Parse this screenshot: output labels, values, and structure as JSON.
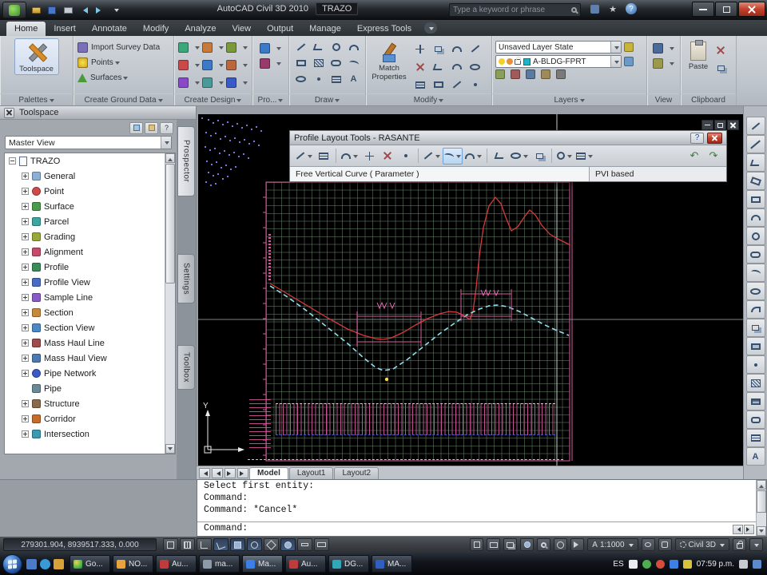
{
  "titlebar": {
    "app_title": "AutoCAD Civil 3D 2010",
    "doc_name": "TRAZO",
    "search_placeholder": "Type a keyword or phrase"
  },
  "tabs": {
    "items": [
      "Home",
      "Insert",
      "Annotate",
      "Modify",
      "Analyze",
      "View",
      "Output",
      "Manage",
      "Express Tools"
    ],
    "active": "Home"
  },
  "ribbon": {
    "palettes": {
      "footer": "Palettes",
      "toolspace_label": "Toolspace"
    },
    "ground": {
      "footer": "Create Ground Data",
      "import_label": "Import Survey Data",
      "points_label": "Points",
      "surfaces_label": "Surfaces"
    },
    "design": {
      "footer": "Create Design"
    },
    "pro": {
      "footer": "Pro..."
    },
    "draw": {
      "footer": "Draw"
    },
    "modify": {
      "footer": "Modify",
      "match_line1": "Match",
      "match_line2": "Properties"
    },
    "layers": {
      "footer": "Layers",
      "state_value": "Unsaved Layer State",
      "layer_value": "A-BLDG-FPRT"
    },
    "view": {
      "footer": "View"
    },
    "clipboard": {
      "footer": "Clipboard",
      "paste_label": "Paste"
    }
  },
  "toolspace": {
    "title": "Toolspace",
    "combo_value": "Master View",
    "root": "TRAZO",
    "items": [
      "General",
      "Point",
      "Surface",
      "Parcel",
      "Grading",
      "Alignment",
      "Profile",
      "Profile View",
      "Sample Line",
      "Section",
      "Section View",
      "Mass Haul Line",
      "Mass Haul View",
      "Pipe Network",
      "Pipe",
      "Structure",
      "Corridor",
      "Intersection"
    ],
    "tabs": [
      "Prospector",
      "Settings",
      "Toolbox"
    ]
  },
  "profile_tools": {
    "title": "Profile Layout Tools - RASANTE",
    "status_left": "Free Vertical Curve ( Parameter )",
    "status_right": "PVI based"
  },
  "canvas": {
    "ucs_label": "Y"
  },
  "layout_tabs": [
    "Model",
    "Layout1",
    "Layout2"
  ],
  "command": {
    "history": [
      "Select first entity:",
      "Command:",
      "Command: *Cancel*"
    ],
    "prompt": "Command:"
  },
  "statusbar": {
    "coords": "279301.904, 8939517.333, 0.000",
    "annotation_scale": "1:1000",
    "workspace": "Civil 3D"
  },
  "taskbar": {
    "tasks": [
      "Go...",
      "NO...",
      "Au...",
      "ma...",
      "Ma...",
      "Au...",
      "DG...",
      "MA..."
    ],
    "language": "ES",
    "clock": "07:59 p.m."
  },
  "glyphs": {
    "help": "?",
    "star": "★",
    "undo": "↶",
    "redo": "↷",
    "annotation": "A",
    "text_tool": "A"
  }
}
